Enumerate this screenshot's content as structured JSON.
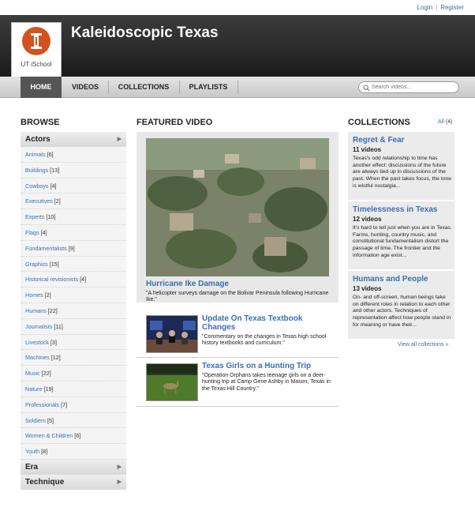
{
  "util_links": {
    "login": "Login",
    "separator": "|",
    "register": "Register"
  },
  "header": {
    "logo_text": "UT iSchool",
    "title": "Kaleidoscopic Texas"
  },
  "nav": {
    "items": [
      {
        "label": "HOME",
        "active": true
      },
      {
        "label": "VIDEOS",
        "active": false
      },
      {
        "label": "COLLECTIONS",
        "active": false
      },
      {
        "label": "PLAYLISTS",
        "active": false
      }
    ],
    "search_placeholder": "Search videos..."
  },
  "browse": {
    "heading": "BROWSE",
    "categories": [
      {
        "label": "Actors",
        "arrow": "▶"
      },
      {
        "label": "Era",
        "arrow": "▶"
      },
      {
        "label": "Technique",
        "arrow": "▶"
      }
    ],
    "actors": [
      {
        "label": "Animals",
        "count": "[6]"
      },
      {
        "label": "Buildings",
        "count": "[13]"
      },
      {
        "label": "Cowboys",
        "count": "[4]"
      },
      {
        "label": "Executives",
        "count": "[2]"
      },
      {
        "label": "Experts",
        "count": "[10]"
      },
      {
        "label": "Flags",
        "count": "[4]"
      },
      {
        "label": "Fundamentalists",
        "count": "[9]"
      },
      {
        "label": "Graphics",
        "count": "[15]"
      },
      {
        "label": "Historical revisionists",
        "count": "[4]"
      },
      {
        "label": "Homes",
        "count": "[2]"
      },
      {
        "label": "Humans",
        "count": "[22]"
      },
      {
        "label": "Journalists",
        "count": "[11]"
      },
      {
        "label": "Livestock",
        "count": "[3]"
      },
      {
        "label": "Machines",
        "count": "[12]"
      },
      {
        "label": "Music",
        "count": "[22]"
      },
      {
        "label": "Nature",
        "count": "[19]"
      },
      {
        "label": "Professionals",
        "count": "[7]"
      },
      {
        "label": "Soldiers",
        "count": "[5]"
      },
      {
        "label": "Women & Children",
        "count": "[6]"
      },
      {
        "label": "Youth",
        "count": "[8]"
      }
    ]
  },
  "featured": {
    "heading": "FEATURED VIDEO",
    "main": {
      "title": "Hurricane Ike Damage",
      "description": "\"A helicopter surveys damage on the Bolivar Peninsula following Hurricane Ike.\""
    },
    "videos": [
      {
        "title": "Update On Texas Textbook Changes",
        "description": "\"Commentary on the changes in Texas high school history textbooks and curriculum.\""
      },
      {
        "title": "Texas Girls on a Hunting Trip",
        "description": "\"Operation Orphans takes teenage girls on a deer-hunting trip at Camp Gene Ashby in Mason, Texas in the Texas Hill Country.\""
      }
    ]
  },
  "collections": {
    "heading": "COLLECTIONS",
    "all_label": "All",
    "all_count": "(4)",
    "items": [
      {
        "title": "Regret & Fear",
        "count": "11 videos",
        "description": "Texas's odd relationship to time has another effect: discussions of the future are always tied up in discussions of the past. When the past takes focus, the tone is wistful nostalgia..."
      },
      {
        "title": "Timelessness in Texas",
        "count": "12 videos",
        "description": "It's hard to tell just when you are in Texas. Farms, hunting, country music, and constitutional fundamentalism distort the passage of time. The frontier and the information age exist..."
      },
      {
        "title": "Humans and People",
        "count": "13 videos",
        "description": "On- and off-screen, human beings take on different roles in relation to each other and other actors. Techniques of representation affect how people stand in for meaning or have their..."
      }
    ],
    "view_all": "View all collections »"
  },
  "colors": {
    "link": "#3a6fb0",
    "header_dark": "#2a2a2a",
    "logo_orange": "#d4521f"
  },
  "icons": [
    "logo-pillar-icon",
    "search-icon",
    "arrow-right-icon"
  ]
}
